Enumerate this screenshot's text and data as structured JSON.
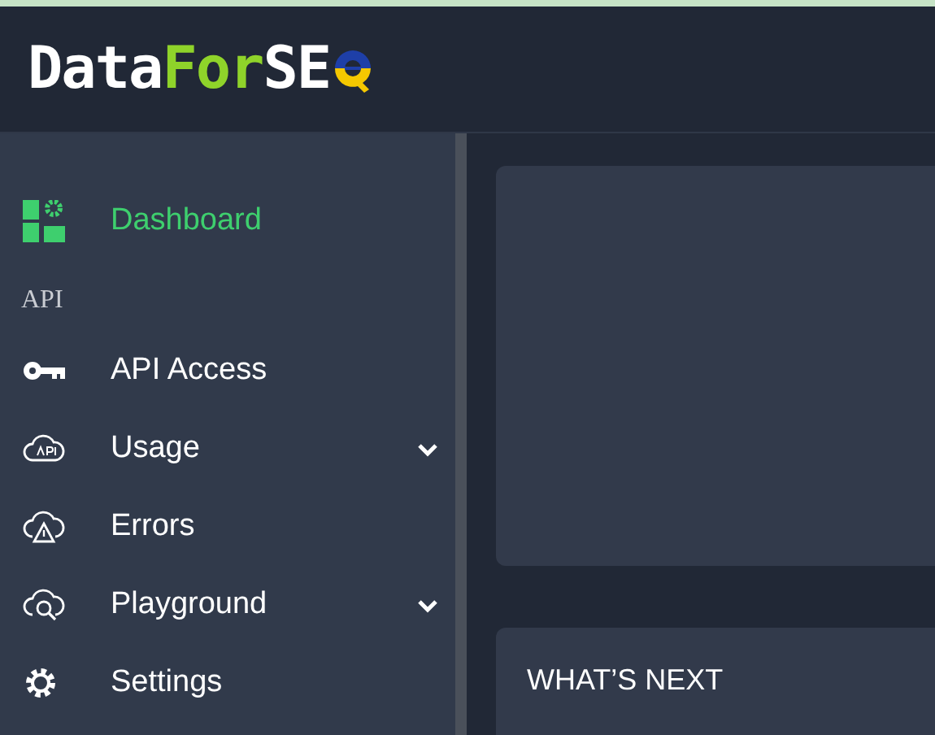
{
  "logo": {
    "parts": [
      "Data",
      "For",
      "SE"
    ]
  },
  "sidebar": {
    "items": [
      {
        "label": "Dashboard",
        "selected": true,
        "kind": "link"
      }
    ],
    "sections": [
      {
        "title": "API",
        "items": [
          {
            "label": "API Access",
            "selected": false,
            "kind": "link"
          },
          {
            "label": "Usage",
            "selected": false,
            "kind": "submenu"
          },
          {
            "label": "Errors",
            "selected": false,
            "kind": "link"
          },
          {
            "label": "Playground",
            "selected": false,
            "kind": "submenu"
          },
          {
            "label": "Settings",
            "selected": false,
            "kind": "link"
          }
        ]
      }
    ]
  },
  "cards": [
    {
      "kind": "blank"
    },
    {
      "kind": "titled",
      "title": "WHAT’S NEXT"
    }
  ]
}
